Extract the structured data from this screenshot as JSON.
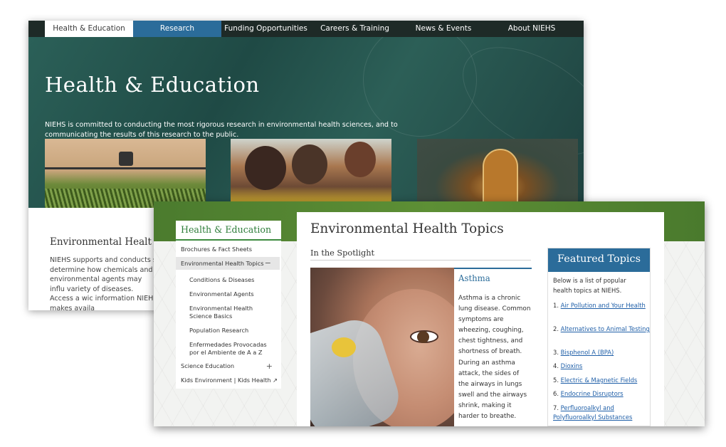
{
  "back_window": {
    "nav": [
      {
        "label": "Health & Education"
      },
      {
        "label": "Research"
      },
      {
        "label": "Funding Opportunities"
      },
      {
        "label": "Careers & Training"
      },
      {
        "label": "News & Events"
      },
      {
        "label": "About NIEHS"
      }
    ],
    "hero_title": "Health & Education",
    "hero_description": "NIEHS is committed to conducting the most rigorous research in environmental health sciences, and to communicating the results of this research to the public.",
    "card_title": "Environmental Healt",
    "card_text": "NIEHS supports and conducts s determine how chemicals and environmental agents may influ variety of diseases. Access a wic information NIEHS makes availa"
  },
  "front_window": {
    "sidebar": {
      "title": "Health & Education",
      "items": [
        {
          "label": "Brochures & Fact Sheets",
          "sign": ""
        },
        {
          "label": "Environmental Health Topics",
          "sign": "−"
        },
        {
          "label": "Conditions & Diseases",
          "sign": ""
        },
        {
          "label": "Environmental Agents",
          "sign": ""
        },
        {
          "label": "Environmental Health Science Basics",
          "sign": ""
        },
        {
          "label": "Population Research",
          "sign": ""
        },
        {
          "label": "Enfermedades Provocadas por el Ambiente de A a Z",
          "sign": ""
        },
        {
          "label": "Science Education",
          "sign": "+"
        },
        {
          "label": "Kids Environment | Kids Health ↗",
          "sign": ""
        }
      ]
    },
    "main_title": "Environmental Health Topics",
    "spotlight": {
      "heading": "In the Spotlight",
      "title": "Asthma",
      "text": "Asthma is a chronic lung disease. Common symptoms are wheezing, coughing, chest tightness, and shortness of breath. During an asthma attack, the sides of the airways in lungs swell and the airways shrink, making it harder to breathe."
    },
    "featured": {
      "heading": "Featured Topics",
      "intro": "Below is a list of popular health topics at NIEHS.",
      "items": [
        {
          "num": "1.",
          "label": "Air Pollution and Your Health"
        },
        {
          "num": "2.",
          "label": "Alternatives to Animal Testing"
        },
        {
          "num": "3.",
          "label": "Bisphenol A (BPA)"
        },
        {
          "num": "4.",
          "label": "Dioxins"
        },
        {
          "num": "5.",
          "label": "Electric & Magnetic Fields"
        },
        {
          "num": "6.",
          "label": "Endocrine Disruptors"
        },
        {
          "num": "7.",
          "label": "Perfluoroalkyl and Polyfluoroalkyl Substances"
        }
      ]
    }
  }
}
